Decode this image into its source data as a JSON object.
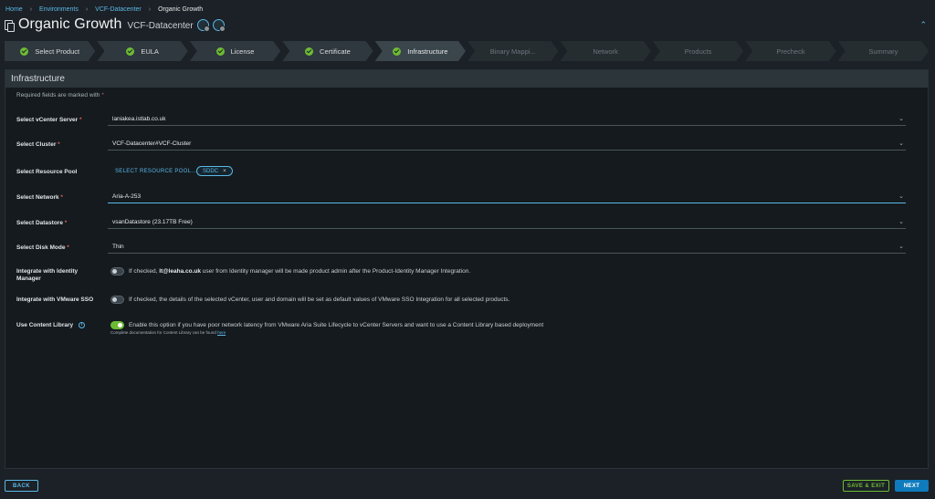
{
  "breadcrumb": {
    "home": "Home",
    "environments": "Environments",
    "datacenter": "VCF-Datacenter",
    "current": "Organic Growth"
  },
  "header": {
    "title": "Organic Growth",
    "subtitle": "VCF-Datacenter"
  },
  "steps": [
    {
      "label": "Select Product",
      "state": "done"
    },
    {
      "label": "EULA",
      "state": "done"
    },
    {
      "label": "License",
      "state": "done"
    },
    {
      "label": "Certificate",
      "state": "done"
    },
    {
      "label": "Infrastructure",
      "state": "active"
    },
    {
      "label": "Binary Mappi...",
      "state": "todo"
    },
    {
      "label": "Network",
      "state": "todo"
    },
    {
      "label": "Products",
      "state": "todo"
    },
    {
      "label": "Precheck",
      "state": "todo"
    },
    {
      "label": "Summary",
      "state": "todo"
    }
  ],
  "panel": {
    "title": "Infrastructure",
    "required_note": "Required fields are marked with",
    "required_star": "*"
  },
  "fields": {
    "vcenter": {
      "label": "Select vCenter Server",
      "value": "laniakea.istlab.co.uk"
    },
    "cluster": {
      "label": "Select Cluster",
      "value": "VCF-Datacenter#VCF-Cluster"
    },
    "pool": {
      "label": "Select Resource Pool",
      "link": "SELECT RESOURCE POOL...",
      "chip": "SDDC"
    },
    "network": {
      "label": "Select Network",
      "value": "Aria-A-253"
    },
    "datastore": {
      "label": "Select Datastore",
      "value": "vsanDatastore (23.17TB Free)"
    },
    "diskmode": {
      "label": "Select Disk Mode",
      "value": "Thin"
    },
    "identity": {
      "label": "Integrate with Identity Manager",
      "text_pre": "If checked, ",
      "text_user": "lt@leaha.co.uk",
      "text_post": " user from Identity manager will be made product admin after the Product-Identity Manager Integration.",
      "enabled": false
    },
    "sso": {
      "label": "Integrate with VMware SSO",
      "text": "If checked, the details of the selected vCenter, user and domain will be set as default values of VMware SSO Integration for all selected products.",
      "enabled": false
    },
    "library": {
      "label": "Use Content Library",
      "text": "Enable this option if you have poor network latency from VMware Aria Suite Lifecycle to vCenter Servers and want to use a Content Library based deployment",
      "enabled": true,
      "info_icon": "i"
    }
  },
  "doc_note": {
    "text": "Complete documentation for Content Library can be found ",
    "link": "here"
  },
  "footer": {
    "back": "BACK",
    "save_exit": "SAVE & EXIT",
    "next": "NEXT"
  }
}
